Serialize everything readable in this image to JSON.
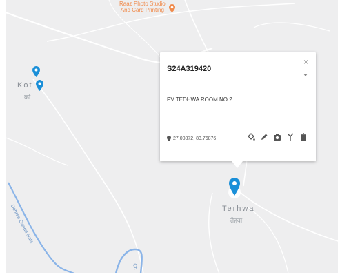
{
  "map": {
    "poi": {
      "line1": "Raaz Photo Studio",
      "line2": "And Card Printing"
    },
    "town_left": {
      "name": "Kot a",
      "local": "को"
    },
    "town_center": {
      "name": "Terhwa",
      "local": "तेहवा"
    },
    "river": {
      "label": "Dohree Ganda Nala",
      "label2": "Ch"
    }
  },
  "popup": {
    "site_id": "S24A319420",
    "site_name": "PV TEDHWA ROOM NO 2",
    "coordinates": "27.00872, 83.76876",
    "close_glyph": "×"
  },
  "colors": {
    "marker": "#1a8fd8",
    "poi": "#f08a4b",
    "water": "#8ab4e8"
  }
}
